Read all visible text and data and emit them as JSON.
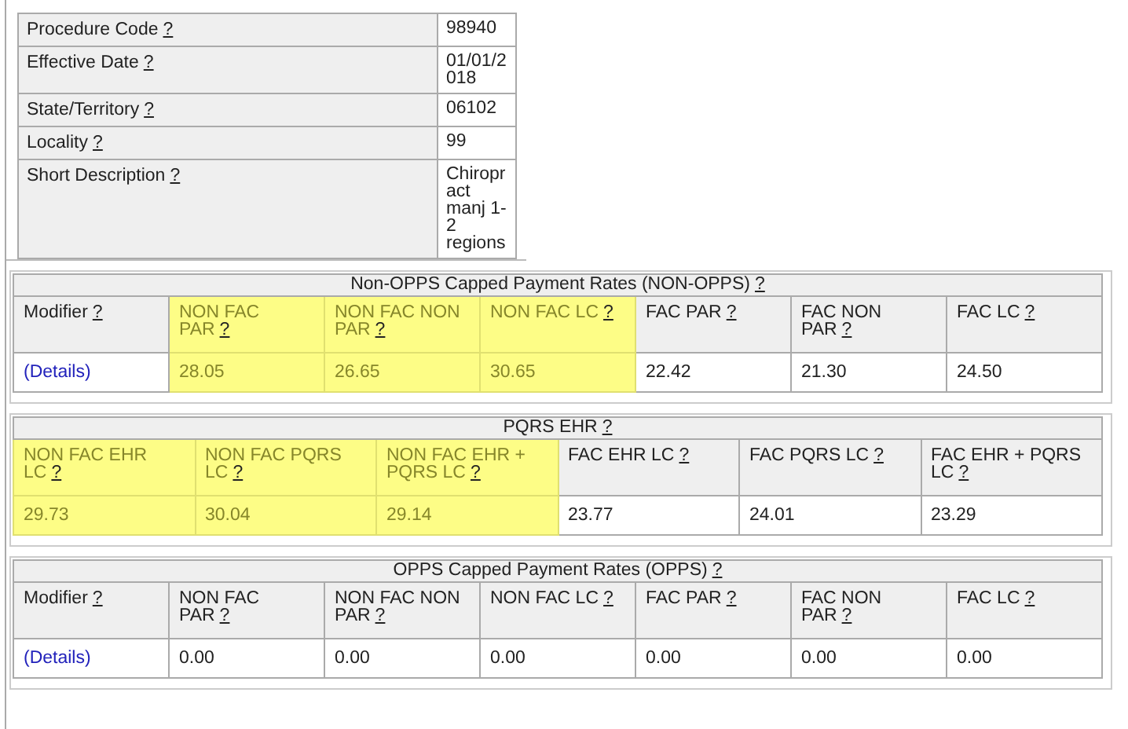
{
  "details": [
    {
      "label": "Procedure Code",
      "help": "?",
      "value": "98940"
    },
    {
      "label": "Effective Date",
      "help": "?",
      "value": "01/01/2018"
    },
    {
      "label": "State/Territory",
      "help": "?",
      "value": "06102"
    },
    {
      "label": "Locality",
      "help": "?",
      "value": "99"
    },
    {
      "label": "Short Description",
      "help": "?",
      "value": "Chiropract manj 1-2 regions"
    }
  ],
  "sections": [
    {
      "title": "Non-OPPS Capped Payment Rates (NON-OPPS)",
      "help": "?",
      "columns": [
        {
          "label": "Modifier",
          "help": "?",
          "highlighted": false
        },
        {
          "label": "NON FAC PAR",
          "help": "?",
          "highlighted": true
        },
        {
          "label": "NON FAC NON PAR",
          "help": "?",
          "highlighted": true
        },
        {
          "label": "NON FAC LC",
          "help": "?",
          "highlighted": true
        },
        {
          "label": "FAC PAR",
          "help": "?",
          "highlighted": false
        },
        {
          "label": "FAC NON PAR",
          "help": "?",
          "highlighted": false
        },
        {
          "label": "FAC LC",
          "help": "?",
          "highlighted": false
        }
      ],
      "rows": [
        [
          {
            "kind": "link",
            "text": "(Details)"
          },
          {
            "kind": "value",
            "text": "28.05"
          },
          {
            "kind": "value",
            "text": "26.65"
          },
          {
            "kind": "value",
            "text": "30.65"
          },
          {
            "kind": "value",
            "text": "22.42"
          },
          {
            "kind": "value",
            "text": "21.30"
          },
          {
            "kind": "value",
            "text": "24.50"
          }
        ]
      ]
    },
    {
      "title": "PQRS EHR",
      "help": "?",
      "columns": [
        {
          "label": "NON FAC EHR LC",
          "help": "?",
          "highlighted": true
        },
        {
          "label": "NON FAC PQRS LC",
          "help": "?",
          "highlighted": true
        },
        {
          "label": "NON FAC EHR + PQRS LC",
          "help": "?",
          "highlighted": true
        },
        {
          "label": "FAC EHR LC",
          "help": "?",
          "highlighted": false
        },
        {
          "label": "FAC PQRS LC",
          "help": "?",
          "highlighted": false
        },
        {
          "label": "FAC EHR + PQRS LC",
          "help": "?",
          "highlighted": false
        }
      ],
      "rows": [
        [
          {
            "kind": "value",
            "text": "29.73"
          },
          {
            "kind": "value",
            "text": "30.04"
          },
          {
            "kind": "value",
            "text": "29.14"
          },
          {
            "kind": "value",
            "text": "23.77"
          },
          {
            "kind": "value",
            "text": "24.01"
          },
          {
            "kind": "value",
            "text": "23.29"
          }
        ]
      ]
    },
    {
      "title": "OPPS Capped Payment Rates (OPPS)",
      "help": "?",
      "columns": [
        {
          "label": "Modifier",
          "help": "?",
          "highlighted": false
        },
        {
          "label": "NON FAC PAR",
          "help": "?",
          "highlighted": false
        },
        {
          "label": "NON FAC NON PAR",
          "help": "?",
          "highlighted": false
        },
        {
          "label": "NON FAC LC",
          "help": "?",
          "highlighted": false
        },
        {
          "label": "FAC PAR",
          "help": "?",
          "highlighted": false
        },
        {
          "label": "FAC NON PAR",
          "help": "?",
          "highlighted": false
        },
        {
          "label": "FAC LC",
          "help": "?",
          "highlighted": false
        }
      ],
      "rows": [
        [
          {
            "kind": "link",
            "text": "(Details)"
          },
          {
            "kind": "value",
            "text": "0.00"
          },
          {
            "kind": "value",
            "text": "0.00"
          },
          {
            "kind": "value",
            "text": "0.00"
          },
          {
            "kind": "value",
            "text": "0.00"
          },
          {
            "kind": "value",
            "text": "0.00"
          },
          {
            "kind": "value",
            "text": "0.00"
          }
        ]
      ]
    }
  ]
}
